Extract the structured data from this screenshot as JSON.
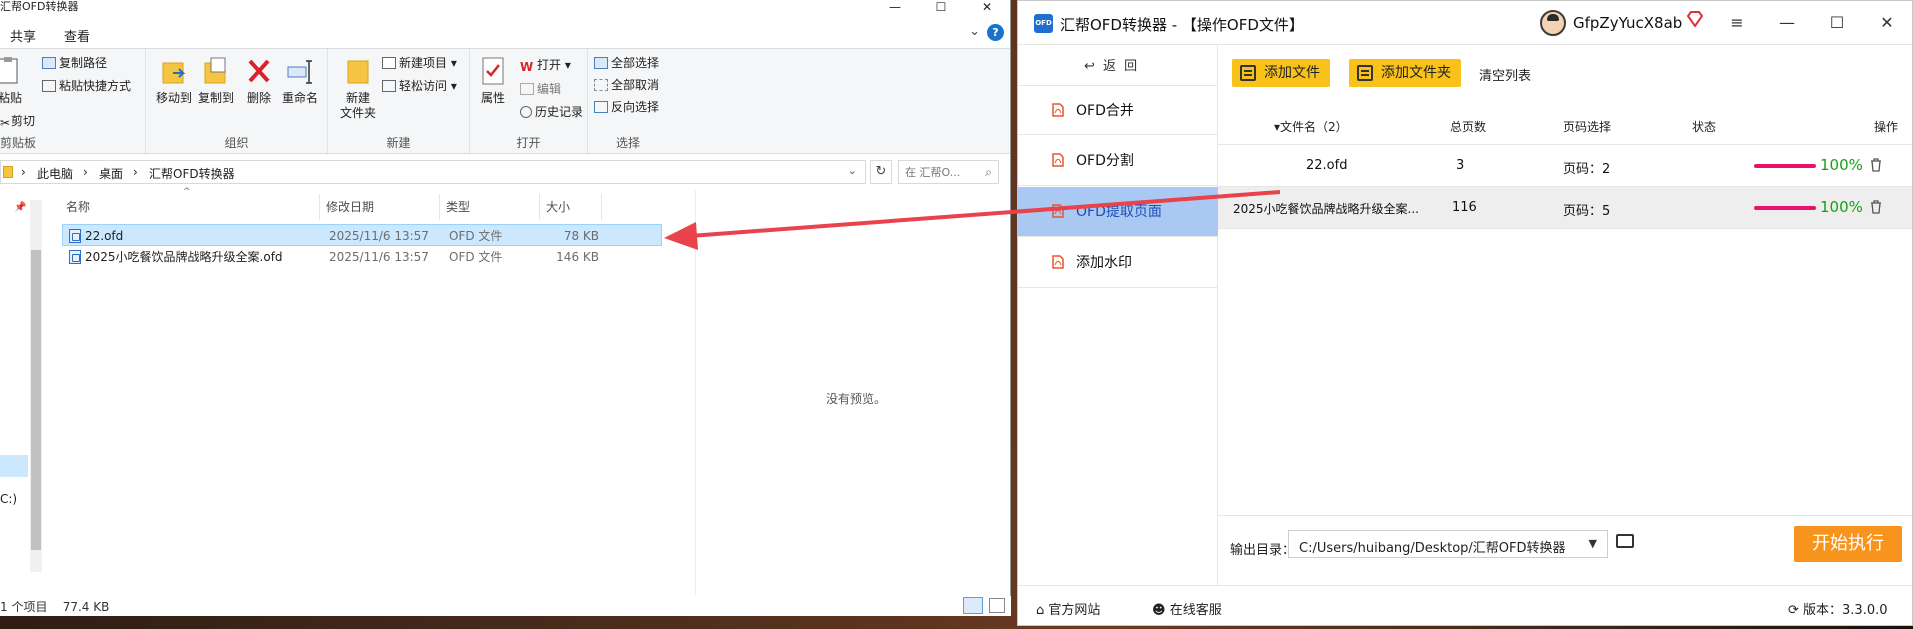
{
  "explorer": {
    "title": "汇帮OFD转换器",
    "tabs": [
      "共享",
      "查看"
    ],
    "ribbon": {
      "clipboard": {
        "paste": "粘贴",
        "copy_path": "复制路径",
        "paste_shortcut": "粘贴快捷方式",
        "cut": "剪切",
        "label": "剪贴板"
      },
      "organize": {
        "move_to": "移动到",
        "copy_to": "复制到",
        "delete": "删除",
        "rename": "重命名",
        "label": "组织"
      },
      "new": {
        "new_folder": "新建\n文件夹",
        "new_item": "新建项目",
        "easy_access": "轻松访问",
        "label": "新建"
      },
      "open": {
        "properties": "属性",
        "open": "打开",
        "edit": "编辑",
        "history": "历史记录",
        "label": "打开"
      },
      "select": {
        "select_all": "全部选择",
        "select_none": "全部取消",
        "invert": "反向选择",
        "label": "选择"
      }
    },
    "address": {
      "crumbs": [
        "此电脑",
        "桌面",
        "汇帮OFD转换器"
      ]
    },
    "search": {
      "placeholder": "在 汇帮O..."
    },
    "nav": {
      "drive_label": "C:)"
    },
    "columns": [
      "名称",
      "修改日期",
      "类型",
      "大小"
    ],
    "files": [
      {
        "name": "22.ofd",
        "date": "2025/11/6 13:57",
        "type": "OFD 文件",
        "size": "78 KB"
      },
      {
        "name": "2025小吃餐饮品牌战略升级全案.ofd",
        "date": "2025/11/6 13:57",
        "type": "OFD 文件",
        "size": "146 KB"
      }
    ],
    "preview_msg": "没有预览。",
    "status": {
      "count": "1 个项目",
      "selected": "77.4 KB"
    }
  },
  "app": {
    "title": "汇帮OFD转换器 - 【操作OFD文件】",
    "logo": "OFD",
    "user": "GfpZyYucX8ab",
    "back": "返 回",
    "sidebar": [
      "OFD合并",
      "OFD分割",
      "OFD提取页面",
      "添加水印"
    ],
    "toolbar": {
      "add_file": "添加文件",
      "add_folder": "添加文件夹",
      "clear": "清空列表"
    },
    "table": {
      "headers": {
        "name": "文件名（2）",
        "pages": "总页数",
        "select": "页码选择",
        "status": "状态",
        "action": "操作"
      },
      "rows": [
        {
          "name": "22.ofd",
          "pages": "3",
          "select": "页码：2",
          "status": "100%"
        },
        {
          "name": "2025小吃餐饮品牌战略升级全案...",
          "pages": "116",
          "select": "页码：5",
          "status": "100%"
        }
      ]
    },
    "output": {
      "label": "输出目录：",
      "path": "C:/Users/huibang/Desktop/汇帮OFD转换器"
    },
    "start": "开始执行",
    "footer": {
      "website": "官方网站",
      "support": "在线客服",
      "version": "版本：3.3.0.0"
    }
  },
  "colors": {
    "accent_yellow": "#f8c21b",
    "start_orange": "#f7941d",
    "progress": "#e8146c",
    "ok_green": "#18a018",
    "arrow_red": "#e8424a"
  }
}
